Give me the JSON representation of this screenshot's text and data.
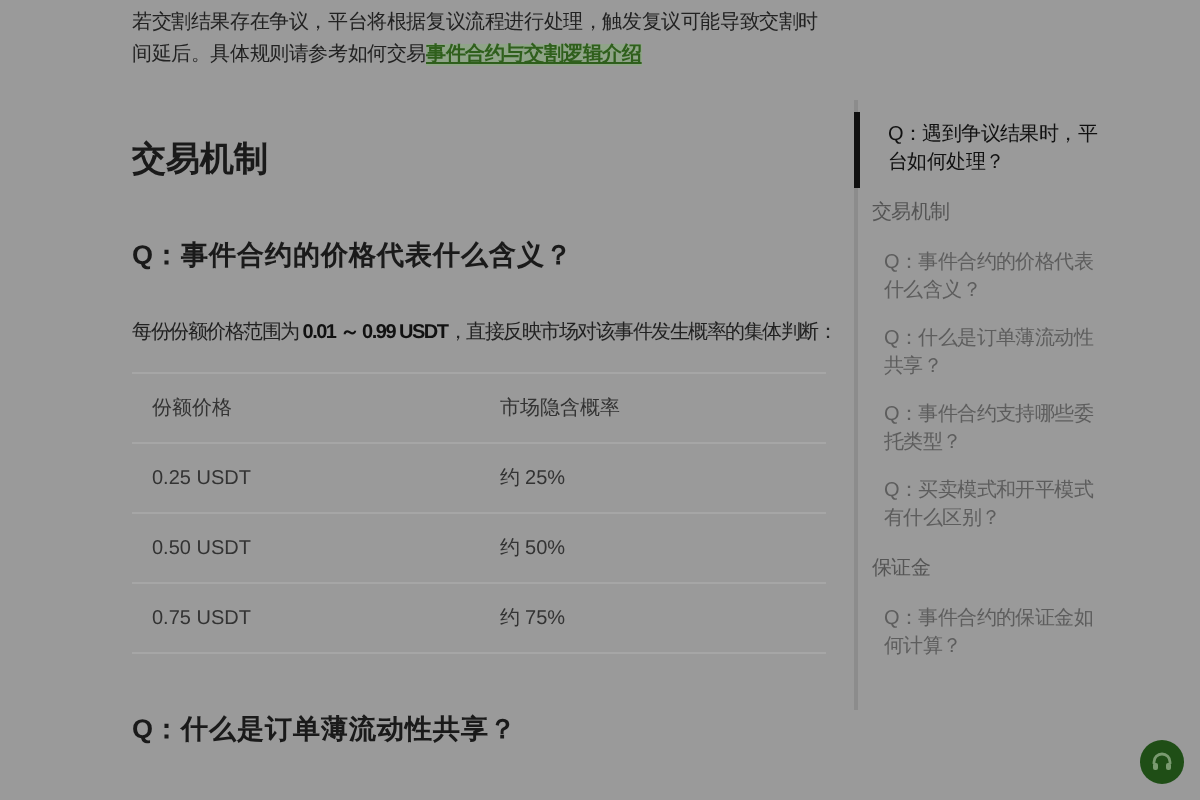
{
  "intro": {
    "text": "若交割结果存在争议，平台将根据复议流程进行处理，触发复议可能导致交割时间延后。具体规则请参考如何交易",
    "link": "事件合约与交割逻辑介绍"
  },
  "section_title": "交易机制",
  "question_1": "Q：事件合约的价格代表什么含义？",
  "paragraph": "每份份额价格范围为 **0.01 ～ 0.99 USDT**，直接反映市场对该事件发生概率的集体判断：",
  "table": {
    "columns": [
      "份额价格",
      "市场隐含概率"
    ],
    "rows": [
      [
        "0.25 USDT",
        "约 25%"
      ],
      [
        "0.50 USDT",
        "约 50%"
      ],
      [
        "0.75 USDT",
        "约 75%"
      ]
    ]
  },
  "question_2": "Q：什么是订单薄流动性共享？",
  "toc": [
    {
      "children": [
        {
          "label": "Q：遇到争议结果时，平台如何处理？",
          "selected": true
        }
      ]
    },
    {
      "label": "交易机制",
      "selected": false,
      "children": [
        {
          "label": "Q：事件合约的价格代表什么含义？",
          "selected": false
        },
        {
          "label": "Q：什么是订单薄流动性共享？",
          "selected": false
        },
        {
          "label": "Q：事件合约支持哪些委托类型？",
          "selected": false
        },
        {
          "label": "Q：买卖模式和开平模式有什么区别？",
          "selected": false
        }
      ]
    },
    {
      "label": "保证金",
      "selected": false,
      "children": [
        {
          "label": "Q：事件合约的保证金如何计算？",
          "selected": false
        }
      ]
    }
  ]
}
